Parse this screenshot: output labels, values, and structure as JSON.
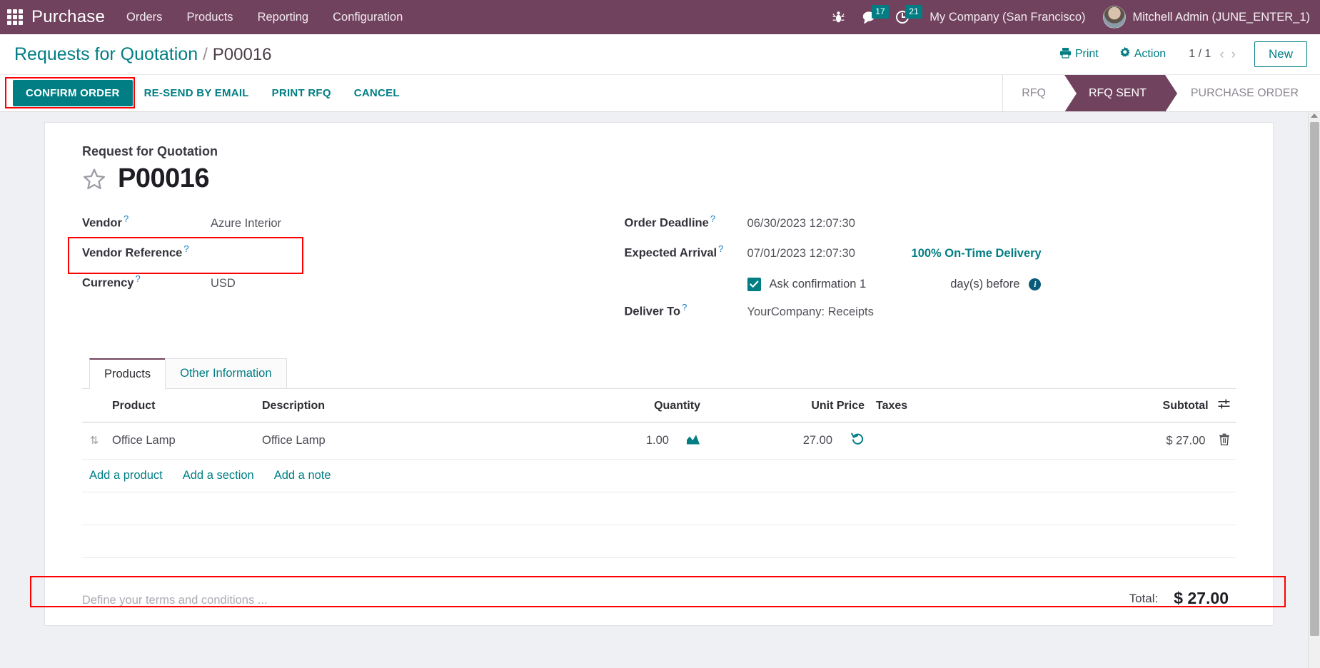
{
  "navbar": {
    "apps_icon": "apps-grid-icon",
    "brand": "Purchase",
    "menu": [
      {
        "label": "Orders"
      },
      {
        "label": "Products"
      },
      {
        "label": "Reporting"
      },
      {
        "label": "Configuration"
      }
    ],
    "bug_icon": "bug-icon",
    "messages": {
      "icon": "chat-bubble-icon",
      "count": "17"
    },
    "activities": {
      "icon": "clock-icon",
      "count": "21"
    },
    "company": "My Company (San Francisco)",
    "user": "Mitchell Admin (JUNE_ENTER_1)",
    "avatar": "user-avatar"
  },
  "controlpanel": {
    "breadcrumb_parent": "Requests for Quotation",
    "breadcrumb_separator": "/",
    "breadcrumb_current": "P00016",
    "print_label": "Print",
    "print_icon": "printer-icon",
    "action_label": "Action",
    "action_icon": "gear-icon",
    "pager": "1 / 1",
    "prev_icon": "chevron-left-icon",
    "next_icon": "chevron-right-icon",
    "new_label": "New"
  },
  "statusbar": {
    "buttons": [
      {
        "label": "CONFIRM ORDER",
        "primary": true
      },
      {
        "label": "RE-SEND BY EMAIL",
        "primary": false
      },
      {
        "label": "PRINT RFQ",
        "primary": false
      },
      {
        "label": "CANCEL",
        "primary": false
      }
    ],
    "stages": [
      {
        "label": "RFQ",
        "active": false
      },
      {
        "label": "RFQ SENT",
        "active": true
      },
      {
        "label": "PURCHASE ORDER",
        "active": false
      }
    ]
  },
  "form": {
    "title_label": "Request for Quotation",
    "star_icon": "star-outline-icon",
    "record_id": "P00016",
    "left_fields": [
      {
        "label": "Vendor",
        "help": "?",
        "value": "Azure Interior"
      },
      {
        "label": "Vendor Reference",
        "help": "?",
        "value": ""
      },
      {
        "label": "Currency",
        "help": "?",
        "value": "USD"
      }
    ],
    "right_fields": [
      {
        "label": "Order Deadline",
        "help": "?",
        "value": "06/30/2023 12:07:30",
        "extra": ""
      },
      {
        "label": "Expected Arrival",
        "help": "?",
        "value": "07/01/2023 12:07:30",
        "extra": "100% On-Time Delivery"
      },
      {
        "label": "Deliver To",
        "help": "?",
        "value": "YourCompany: Receipts",
        "extra": ""
      }
    ],
    "confirmation": {
      "checked": true,
      "text": "Ask confirmation 1",
      "after_text": "day(s) before",
      "info_icon": "info-icon"
    }
  },
  "notebook": {
    "tabs": [
      {
        "label": "Products",
        "active": true
      },
      {
        "label": "Other Information",
        "active": false
      }
    ]
  },
  "lines_table": {
    "headers": [
      "Product",
      "Description",
      "Quantity",
      "Unit Price",
      "Taxes",
      "Subtotal"
    ],
    "sort_icon": "column-options-icon",
    "rows": [
      {
        "handle_icon": "drag-handle-icon",
        "product": "Office Lamp",
        "description": "Office Lamp",
        "quantity": "1.00",
        "quantity_icon": "forecast-chart-icon",
        "unit_price": "27.00",
        "price_icon": "price-history-icon",
        "taxes": "",
        "subtotal": "$ 27.00",
        "delete_icon": "trash-icon"
      }
    ],
    "add_links": [
      {
        "label": "Add a product"
      },
      {
        "label": "Add a section"
      },
      {
        "label": "Add a note"
      }
    ]
  },
  "footer": {
    "terms_placeholder": "Define your terms and conditions ...",
    "total_label": "Total:",
    "total_value": "$ 27.00"
  },
  "colors": {
    "brand_purple": "#71425e",
    "accent_teal": "#017e84",
    "highlight_red": "#ff0000",
    "page_bg": "#eef0f3"
  }
}
